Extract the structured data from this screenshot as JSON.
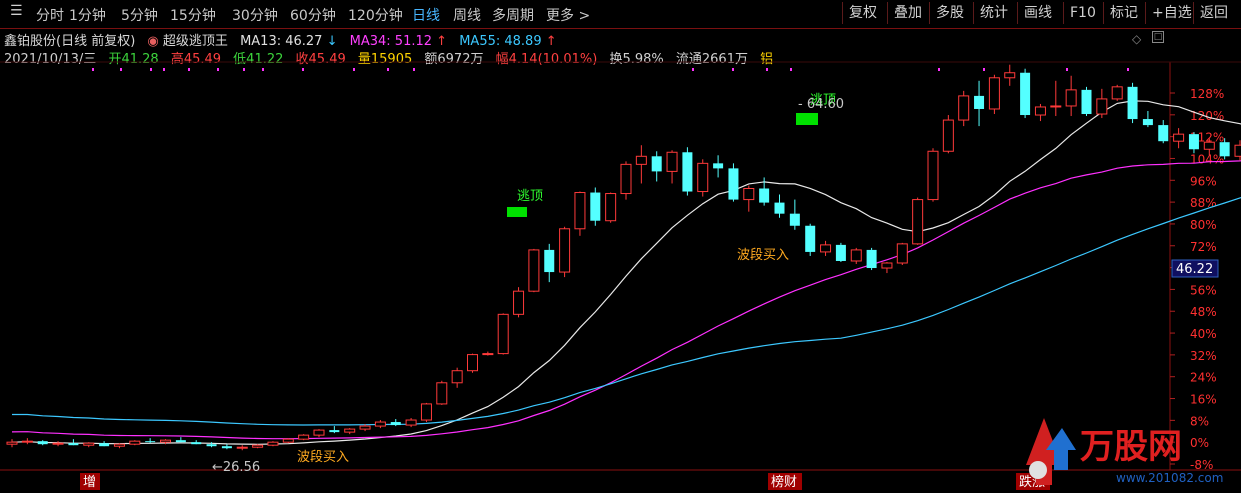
{
  "toolbar": {
    "periods": [
      "分时",
      "1分钟",
      "5分钟",
      "15分钟",
      "30分钟",
      "60分钟",
      "120分钟",
      "日线",
      "周线",
      "多周期",
      "更多 >"
    ],
    "active_period": "日线",
    "buttons": [
      "复权",
      "叠加",
      "多股",
      "统计",
      "画线",
      "F10",
      "标记",
      "+自选",
      "返回"
    ]
  },
  "info": {
    "stock_name": "鑫铂股份(日线 前复权)",
    "indicator_name": "超级逃顶王",
    "ma13": "MA13: 46.27",
    "ma13_arrow": "↓",
    "ma34": "MA34: 51.12",
    "ma34_arrow": "↑",
    "ma55": "MA55: 48.89",
    "ma55_arrow": "↑",
    "date": "2021/10/13/三",
    "open": "开41.28",
    "high": "高45.49",
    "low": "低41.22",
    "close": "收45.49",
    "volume": "量15905",
    "amount": "额6972万",
    "change": "幅4.14(10.01%)",
    "turnover": "换5.98%",
    "float": "流通2661万",
    "sector": "铝"
  },
  "chart_data": {
    "type": "candlestick",
    "y_axis_labels": [
      "128%",
      "120%",
      "112%",
      "104%",
      "96%",
      "88%",
      "80%",
      "72%",
      "64%",
      "56%",
      "48%",
      "40%",
      "32%",
      "24%",
      "16%",
      "8%",
      "0%",
      "-8%"
    ],
    "price_tag": "46.22",
    "high_label": "64.60",
    "low_label": "26.56",
    "annotations": [
      "逃顶",
      "逃顶",
      "波段买入",
      "波段买入"
    ],
    "bottom_tags": [
      "增",
      "榜财",
      "跌涨"
    ],
    "candles": [
      [
        26.9,
        27.4,
        26.6,
        27.1
      ],
      [
        27.1,
        27.5,
        26.9,
        27.2
      ],
      [
        27.2,
        27.3,
        26.8,
        26.9
      ],
      [
        26.9,
        27.2,
        26.7,
        27.0
      ],
      [
        27.0,
        27.4,
        26.8,
        26.8
      ],
      [
        26.8,
        27.1,
        26.6,
        27.0
      ],
      [
        27.0,
        27.2,
        26.7,
        26.7
      ],
      [
        26.7,
        27.0,
        26.5,
        26.9
      ],
      [
        26.9,
        27.3,
        26.8,
        27.2
      ],
      [
        27.2,
        27.5,
        27.0,
        27.1
      ],
      [
        27.1,
        27.4,
        26.9,
        27.3
      ],
      [
        27.3,
        27.6,
        27.1,
        27.1
      ],
      [
        27.1,
        27.3,
        26.9,
        26.9
      ],
      [
        26.9,
        27.1,
        26.6,
        26.7
      ],
      [
        26.7,
        26.9,
        26.4,
        26.5
      ],
      [
        26.5,
        26.8,
        26.3,
        26.6
      ],
      [
        26.6,
        26.9,
        26.5,
        26.8
      ],
      [
        26.8,
        27.2,
        26.7,
        27.1
      ],
      [
        27.1,
        27.5,
        27.0,
        27.4
      ],
      [
        27.4,
        27.9,
        27.3,
        27.8
      ],
      [
        27.8,
        28.4,
        27.6,
        28.3
      ],
      [
        28.3,
        28.7,
        28.0,
        28.1
      ],
      [
        28.1,
        28.5,
        27.9,
        28.4
      ],
      [
        28.4,
        28.9,
        28.2,
        28.7
      ],
      [
        28.7,
        29.3,
        28.5,
        29.1
      ],
      [
        29.1,
        29.4,
        28.7,
        28.8
      ],
      [
        28.8,
        29.5,
        28.6,
        29.3
      ],
      [
        29.3,
        31.0,
        29.1,
        30.9
      ],
      [
        30.9,
        33.2,
        30.8,
        33.0
      ],
      [
        33.0,
        34.5,
        32.5,
        34.2
      ],
      [
        34.2,
        35.9,
        34.0,
        35.8
      ],
      [
        35.8,
        36.1,
        35.7,
        35.9
      ],
      [
        35.9,
        39.9,
        35.8,
        39.8
      ],
      [
        39.8,
        42.5,
        39.5,
        42.1
      ],
      [
        42.1,
        46.3,
        42.0,
        46.2
      ],
      [
        46.2,
        46.8,
        43.0,
        44.0
      ],
      [
        44.0,
        48.5,
        43.5,
        48.3
      ],
      [
        48.3,
        52.0,
        47.6,
        51.9
      ],
      [
        51.9,
        52.4,
        48.6,
        49.1
      ],
      [
        49.1,
        51.9,
        48.9,
        51.8
      ],
      [
        51.8,
        55.0,
        51.2,
        54.7
      ],
      [
        54.7,
        56.6,
        52.8,
        55.5
      ],
      [
        55.5,
        56.0,
        53.0,
        54.0
      ],
      [
        54.0,
        56.1,
        52.8,
        55.9
      ],
      [
        55.9,
        56.4,
        51.6,
        52.0
      ],
      [
        52.0,
        55.2,
        51.5,
        54.8
      ],
      [
        54.8,
        55.6,
        53.4,
        54.3
      ],
      [
        54.3,
        54.8,
        51.0,
        51.2
      ],
      [
        51.2,
        52.6,
        50.0,
        52.3
      ],
      [
        52.3,
        53.4,
        50.6,
        50.9
      ],
      [
        50.9,
        51.7,
        49.4,
        49.8
      ],
      [
        49.8,
        51.2,
        48.2,
        48.6
      ],
      [
        48.6,
        48.8,
        45.6,
        46.0
      ],
      [
        46.0,
        47.1,
        45.6,
        46.7
      ],
      [
        46.7,
        46.9,
        45.0,
        45.1
      ],
      [
        45.1,
        46.4,
        44.8,
        46.2
      ],
      [
        46.2,
        46.4,
        44.2,
        44.4
      ],
      [
        44.4,
        45.0,
        43.9,
        44.9
      ],
      [
        44.9,
        46.9,
        44.7,
        46.8
      ],
      [
        46.8,
        51.4,
        46.7,
        51.2
      ],
      [
        51.2,
        56.3,
        51.0,
        56.0
      ],
      [
        56.0,
        59.6,
        55.8,
        59.1
      ],
      [
        59.1,
        62.0,
        58.5,
        61.5
      ],
      [
        61.5,
        63.0,
        58.5,
        60.2
      ],
      [
        60.2,
        63.6,
        59.7,
        63.3
      ],
      [
        63.3,
        64.6,
        62.5,
        63.8
      ],
      [
        63.8,
        64.2,
        59.3,
        59.6
      ],
      [
        59.6,
        60.7,
        59.0,
        60.4
      ],
      [
        60.4,
        63.0,
        59.5,
        60.5
      ],
      [
        60.5,
        63.5,
        59.5,
        62.1
      ],
      [
        62.1,
        62.4,
        59.5,
        59.7
      ],
      [
        59.7,
        62.2,
        59.3,
        61.2
      ],
      [
        61.2,
        62.6,
        61.0,
        62.4
      ],
      [
        62.4,
        62.8,
        58.8,
        59.2
      ],
      [
        59.2,
        60.0,
        58.4,
        58.6
      ],
      [
        58.6,
        59.1,
        56.8,
        57.0
      ],
      [
        57.0,
        58.3,
        56.3,
        57.7
      ],
      [
        57.7,
        57.9,
        55.8,
        56.2
      ],
      [
        56.2,
        57.3,
        55.6,
        56.9
      ],
      [
        56.9,
        57.3,
        55.2,
        55.5
      ],
      [
        55.5,
        57.1,
        55.1,
        56.6
      ],
      [
        56.6,
        56.9,
        54.7,
        54.9
      ],
      [
        54.9,
        55.7,
        53.6,
        53.7
      ],
      [
        53.7,
        54.7,
        51.5,
        51.8
      ],
      [
        51.8,
        53.9,
        51.7,
        53.5
      ],
      [
        53.5,
        53.9,
        52.6,
        53.2
      ],
      [
        53.2,
        53.5,
        52.0,
        52.1
      ],
      [
        52.1,
        52.4,
        51.1,
        51.3
      ],
      [
        51.3,
        51.6,
        48.0,
        48.3
      ],
      [
        48.3,
        51.0,
        48.1,
        50.6
      ],
      [
        50.6,
        53.2,
        50.4,
        53.0
      ],
      [
        53.0,
        53.3,
        50.0,
        50.2
      ],
      [
        50.2,
        50.8,
        49.3,
        49.4
      ],
      [
        49.4,
        50.2,
        48.3,
        48.5
      ],
      [
        48.5,
        48.7,
        47.4,
        47.6
      ],
      [
        47.6,
        48.2,
        46.5,
        46.8
      ],
      [
        46.8,
        47.2,
        45.1,
        45.3
      ],
      [
        45.3,
        45.6,
        41.2,
        41.3
      ],
      [
        41.28,
        45.49,
        41.22,
        45.49
      ]
    ]
  },
  "logo": {
    "text": "万股网",
    "url_text": "www.201082.com"
  }
}
